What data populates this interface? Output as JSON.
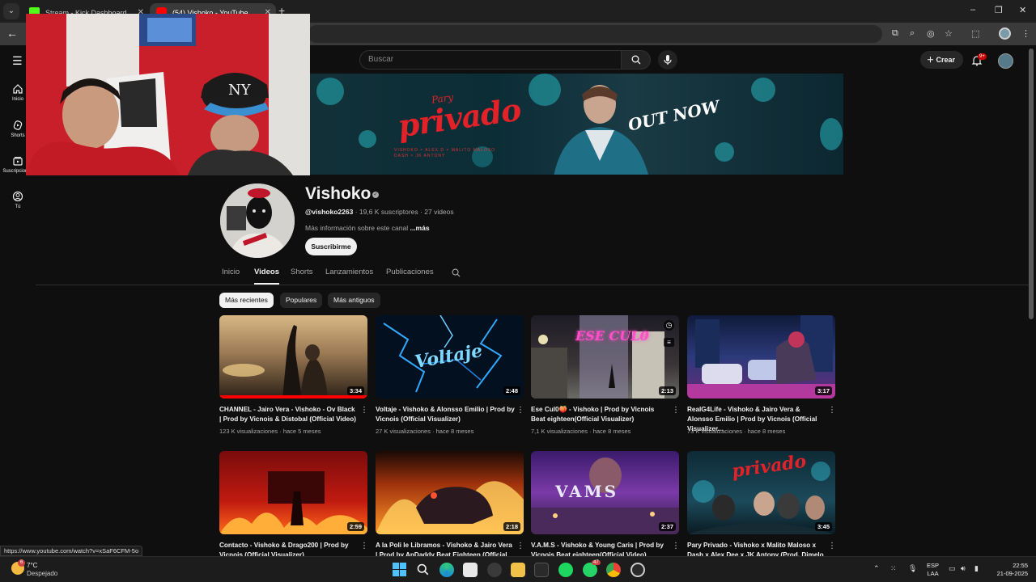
{
  "browser": {
    "tabs": [
      {
        "title": "Stream - Kick Dashboard",
        "favicon_color": "#53fc18"
      },
      {
        "title": "(54) Vishoko - YouTube",
        "favicon_color": "#ff0000"
      }
    ],
    "window_controls": [
      "–",
      "❐",
      "✕"
    ],
    "status_url": "https://www.youtube.com/watch?v=xSaF6CFM-5o"
  },
  "youtube": {
    "search_placeholder": "Buscar",
    "create_label": "Crear",
    "notifications_badge": "9+",
    "guide": [
      {
        "label": "Inicio",
        "icon": "home-icon"
      },
      {
        "label": "Shorts",
        "icon": "shorts-icon"
      },
      {
        "label": "Suscripciones",
        "icon": "subscriptions-icon"
      },
      {
        "label": "Tú",
        "icon": "you-icon"
      }
    ]
  },
  "banner": {
    "pre_title": "Pary",
    "title": "privado",
    "credits_line1": "VISHOKO × ALEX D × MALITO MALOSO",
    "credits_line2": "DASH × JK ANTONY",
    "out_now": "OUT NOW"
  },
  "channel": {
    "name": "Vishoko",
    "handle": "@vishoko2263",
    "subscribers": "19,6 K suscriptores",
    "videos_count": "27 videos",
    "description": "Más información sobre este canal",
    "more_link": "...más",
    "subscribe_label": "Suscribirme",
    "tabs": [
      "Inicio",
      "Videos",
      "Shorts",
      "Lanzamientos",
      "Publicaciones"
    ],
    "active_tab": "Videos",
    "chips": [
      "Más recientes",
      "Populares",
      "Más antiguos"
    ],
    "active_chip": "Más recientes"
  },
  "videos": [
    {
      "title": "CHANNEL - Jairo Vera - Vishoko - Ov Black | Prod by Vicnois & Distobal (Official Video)",
      "views": "123 K visualizaciones",
      "age": "hace 5 meses",
      "duration": "3:34"
    },
    {
      "title": "Voltaje - Vishoko & Alonsso Emilio | Prod by Vicnois (Official Visualizer)",
      "views": "27 K visualizaciones",
      "age": "hace 8 meses",
      "duration": "2:48",
      "thumb_text": "Voltaje"
    },
    {
      "title": "Ese Cul0🍑 - Vishoko | Prod by Vicnois Beat eighteen(Official Visualizer)",
      "views": "7,1 K visualizaciones",
      "age": "hace 8 meses",
      "duration": "2:13",
      "thumb_text": "ESE CUL0"
    },
    {
      "title": "RealG4Life - Vishoko & Jairo Vera & Alonsso Emilio | Prod by Vicnois (Official Visualizer...",
      "views": "73 K visualizaciones",
      "age": "hace 8 meses",
      "duration": "3:17"
    },
    {
      "title": "Contacto - Vishoko & Drago200 | Prod by Vicnois (Official Visualizer)",
      "duration": "2:59"
    },
    {
      "title": "A la Poli le Libramos - Vishoko & Jairo Vera | Prod by AnDaddy Beat Eighteen (Official",
      "duration": "2:18"
    },
    {
      "title": "V.A.M.S - Vishoko & Young Caris | Prod by Vicnois Beat eighteen(Official Video)",
      "duration": "2:37",
      "thumb_text": "VAMS"
    },
    {
      "title": "Pary Privado - Vishoko x Malito Maloso x Dash x Alex Dee x JK Antony (Prod. Dimelo",
      "duration": "3:45",
      "thumb_text": "privado"
    }
  ],
  "taskbar": {
    "weather_badge": "6",
    "temperature": "7°C",
    "condition": "Despejado",
    "whatsapp_badge": "47",
    "lang_line1": "ESP",
    "lang_line2": "LAA",
    "time": "22:55",
    "date": "21-09-2025"
  },
  "colors": {
    "background": "#0f0f0f",
    "subscribe_bg": "#f1f1f1",
    "accent_red": "#e32128"
  }
}
